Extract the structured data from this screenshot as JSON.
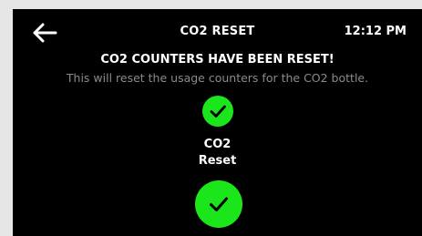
{
  "header": {
    "title": "CO2 RESET",
    "time": "12:12 PM",
    "back_icon": "arrow-left-icon"
  },
  "message": {
    "headline": "CO2 COUNTERS HAVE BEEN RESET!",
    "description": "This will reset the usage counters for the CO2 bottle."
  },
  "status": {
    "icon": "checkmark-icon",
    "label_line1": "CO2",
    "label_line2": "Reset"
  },
  "confirm": {
    "icon": "checkmark-icon"
  },
  "colors": {
    "accent_green": "#1be61b",
    "background": "#000000",
    "frame": "#e6e6e6",
    "muted_text": "#8a8a8a"
  }
}
